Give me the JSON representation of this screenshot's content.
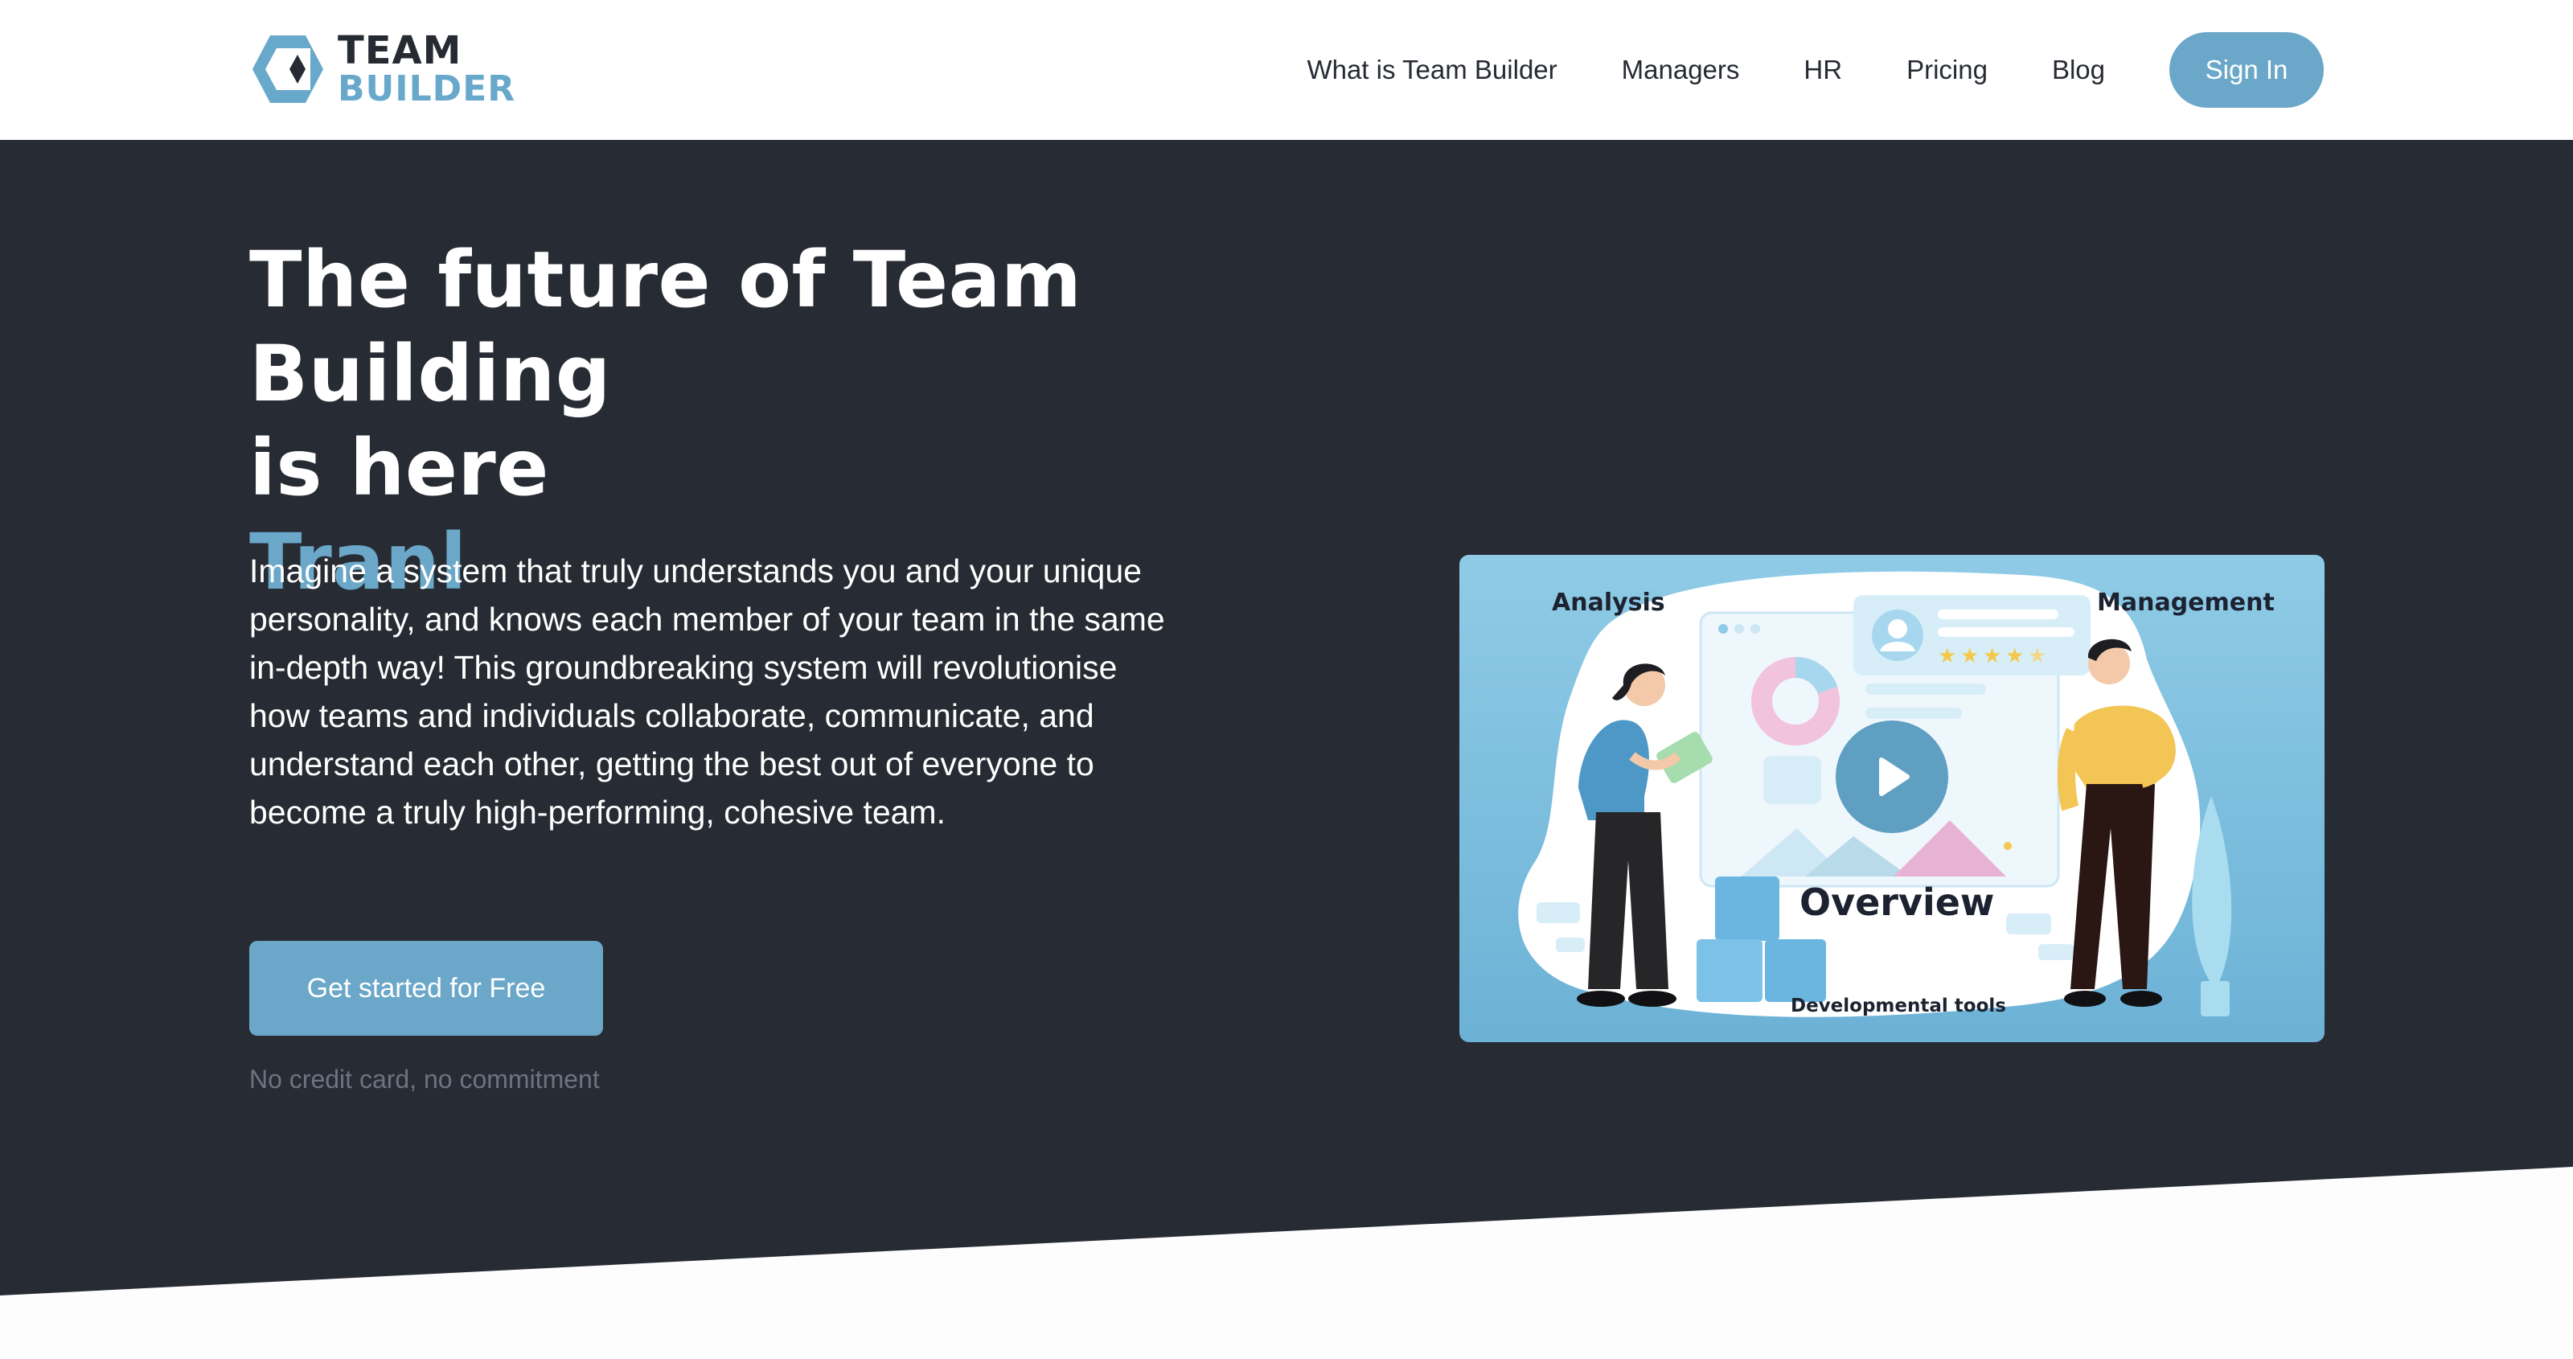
{
  "header": {
    "logo": {
      "line1": "TEAM",
      "line2": "BUILDER"
    },
    "nav": [
      {
        "label": "What is Team Builder"
      },
      {
        "label": "Managers"
      },
      {
        "label": "HR"
      },
      {
        "label": "Pricing"
      },
      {
        "label": "Blog"
      }
    ],
    "signin_label": "Sign In"
  },
  "hero": {
    "headline_line1": "The future of Team Building",
    "headline_line2": "is here",
    "headline_accent": "Tranl",
    "lead": "Imagine a system that truly understands you and your unique personality, and knows each member of your team in the same in-depth way! This groundbreaking system will revolutionise how teams and individuals collaborate, communicate, and understand each other, getting the best out of everyone to become a truly high-performing, cohesive team.",
    "cta_label": "Get started for Free",
    "note": "No credit card, no commitment"
  },
  "video": {
    "label_analysis": "Analysis",
    "label_management": "Management",
    "label_overview": "Overview",
    "label_devtools": "Developmental tools",
    "rating_stars": 4.5,
    "icons": [
      "play-icon",
      "profile-avatar-icon",
      "star-icon",
      "donut-chart-icon",
      "plant-icon"
    ]
  },
  "colors": {
    "accent": "#6aa7c8",
    "hero_bg": "#272b33",
    "dark_text": "#262a33",
    "muted_text": "#6d7380"
  }
}
